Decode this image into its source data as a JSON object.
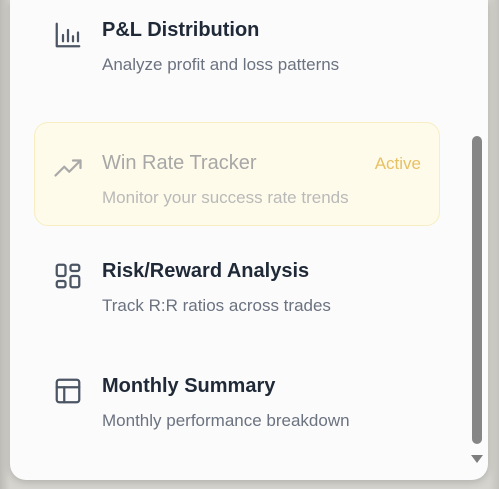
{
  "items": [
    {
      "title": "P&L Distribution",
      "description": "Analyze profit and loss patterns",
      "icon": "bar-chart-icon",
      "active": false
    },
    {
      "title": "Win Rate Tracker",
      "description": "Monitor your success rate trends",
      "icon": "trending-up-icon",
      "active": true,
      "badge": "Active"
    },
    {
      "title": "Risk/Reward Analysis",
      "description": "Track R:R ratios across trades",
      "icon": "dashboard-grid-icon",
      "active": false
    },
    {
      "title": "Monthly Summary",
      "description": "Monthly performance breakdown",
      "icon": "layout-table-icon",
      "active": false
    }
  ],
  "colors": {
    "active_background": "#fefbea",
    "active_border": "#f7eec3",
    "active_badge": "#e8c064",
    "title": "#1f2937",
    "description": "#6b7280",
    "icon": "#4b5563"
  }
}
